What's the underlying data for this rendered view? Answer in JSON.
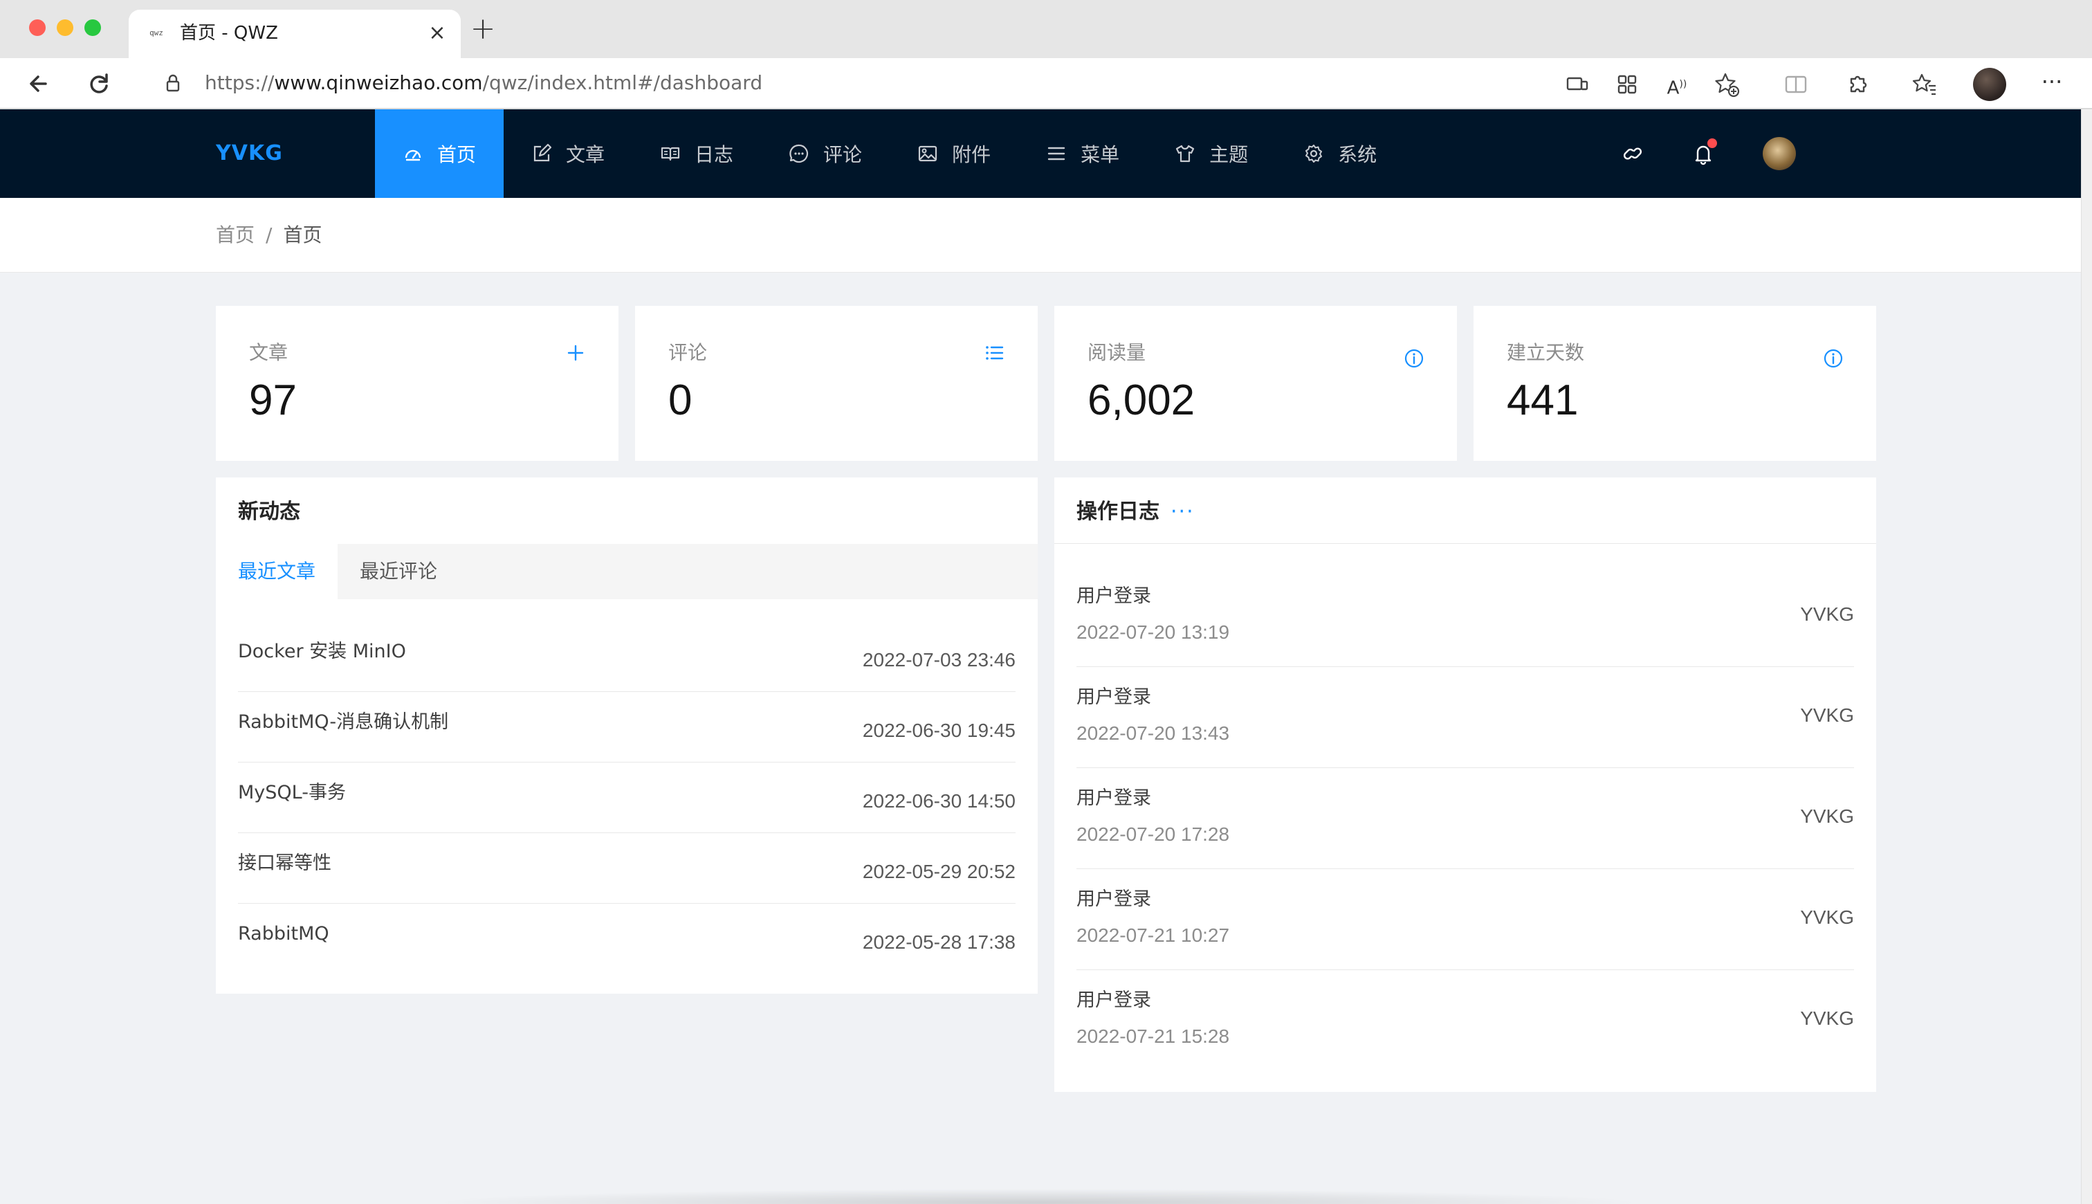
{
  "browser": {
    "tab_title": "首页 - QWZ",
    "tab_favicon": "qwz",
    "url_prefix": "https://",
    "url_domain": "www.qinweizhao.com",
    "url_path": "/qwz/index.html#/dashboard"
  },
  "nav": {
    "brand": "YVKG",
    "items": [
      {
        "label": "首页",
        "icon": "dashboard-icon",
        "active": true
      },
      {
        "label": "文章",
        "icon": "edit-icon"
      },
      {
        "label": "日志",
        "icon": "book-icon"
      },
      {
        "label": "评论",
        "icon": "comment-icon"
      },
      {
        "label": "附件",
        "icon": "picture-icon"
      },
      {
        "label": "菜单",
        "icon": "menu-icon"
      },
      {
        "label": "主题",
        "icon": "shirt-icon"
      },
      {
        "label": "系统",
        "icon": "gear-icon"
      }
    ],
    "tools": [
      "link-icon",
      "bell-icon",
      "avatar"
    ]
  },
  "breadcrumb": {
    "root": "首页",
    "separator": "/",
    "current": "首页"
  },
  "stats": [
    {
      "label": "文章",
      "value": "97",
      "icon": "plus-icon"
    },
    {
      "label": "评论",
      "value": "0",
      "icon": "list-icon"
    },
    {
      "label": "阅读量",
      "value": "6,002",
      "icon": "info-icon"
    },
    {
      "label": "建立天数",
      "value": "441",
      "icon": "info-icon"
    }
  ],
  "activity": {
    "title": "新动态",
    "tabs": [
      "最近文章",
      "最近评论"
    ],
    "articles": [
      {
        "title": "Docker 安装 MinIO",
        "date": "2022-07-03 23:46"
      },
      {
        "title": "RabbitMQ-消息确认机制",
        "date": "2022-06-30 19:45"
      },
      {
        "title": "MySQL-事务",
        "date": "2022-06-30 14:50"
      },
      {
        "title": "接口幂等性",
        "date": "2022-05-29 20:52"
      },
      {
        "title": "RabbitMQ",
        "date": "2022-05-28 17:38"
      }
    ]
  },
  "oplog": {
    "title": "操作日志",
    "more": "···",
    "entries": [
      {
        "action": "用户登录",
        "date": "2022-07-20 13:19",
        "user": "YVKG"
      },
      {
        "action": "用户登录",
        "date": "2022-07-20 13:43",
        "user": "YVKG"
      },
      {
        "action": "用户登录",
        "date": "2022-07-20 17:28",
        "user": "YVKG"
      },
      {
        "action": "用户登录",
        "date": "2022-07-21 10:27",
        "user": "YVKG"
      },
      {
        "action": "用户登录",
        "date": "2022-07-21 15:28",
        "user": "YVKG"
      }
    ]
  },
  "colors": {
    "primary": "#1890ff",
    "nav_bg": "#001529",
    "page_bg": "#f0f2f5",
    "badge": "#ff4d4f"
  }
}
